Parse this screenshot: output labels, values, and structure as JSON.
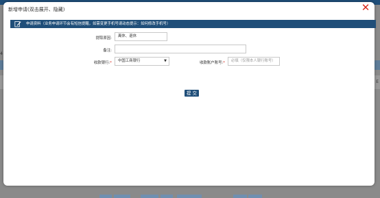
{
  "background": {
    "left_fragment": "4",
    "right_fragment": "d E"
  },
  "dialog": {
    "title": "新增申请(双击展开、隐藏)",
    "close_icon": "close-x-icon",
    "section": {
      "icon": "edit-icon",
      "text": "申请资料（业务申请环节会有短信提醒，如需变更手机号请动态提示：如何修改手机号）"
    },
    "fields": {
      "reason": {
        "label": "提取原因:",
        "value": "离休、退休"
      },
      "remark": {
        "label": "备注:",
        "value": ""
      },
      "bank": {
        "label": "收款银行:",
        "required_mark": "*",
        "value": "中国工商银行"
      },
      "account": {
        "label": "收款账户账号:",
        "required_mark": "*",
        "placeholder": "必填（仅限本人银行账号）"
      }
    },
    "submit_label": "提 交"
  },
  "colors": {
    "header_bg": "#1f4e79",
    "close": "#d62b1f",
    "required": "#d62b1f"
  }
}
